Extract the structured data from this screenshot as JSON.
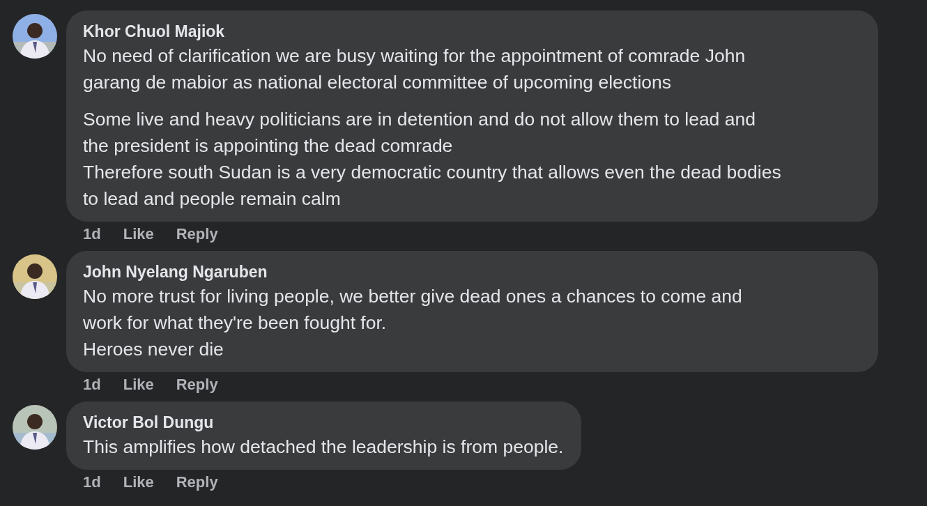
{
  "comments": [
    {
      "author": "Khor Chuol Majiok",
      "avatar": {
        "kind": "picture"
      },
      "paragraphs": [
        [
          "No need of clarification we are busy waiting for the appointment of comrade John",
          "garang de mabior as national electoral committee of upcoming elections"
        ],
        [
          "Some live and heavy politicians are in detention and do not allow them to lead and",
          "the president is appointing the dead comrade",
          "Therefore south Sudan is a very democratic country that allows even the dead bodies",
          "to lead and people remain calm"
        ]
      ],
      "time": "1d",
      "actions": [
        "Like",
        "Reply"
      ]
    },
    {
      "author": "John Nyelang Ngaruben",
      "avatar": {
        "kind": "picture"
      },
      "paragraphs": [
        [
          "No more trust for living people, we better give dead ones a chances to come and",
          "work for what they're been fought for.",
          "Heroes never die"
        ]
      ],
      "time": "1d",
      "actions": [
        "Like",
        "Reply"
      ]
    },
    {
      "author": "Victor Bol Dungu",
      "avatar": {
        "kind": "picture"
      },
      "paragraphs": [
        [
          "This amplifies how detached the leadership is from people."
        ]
      ],
      "time": "1d",
      "actions": [
        "Like",
        "Reply"
      ]
    }
  ]
}
